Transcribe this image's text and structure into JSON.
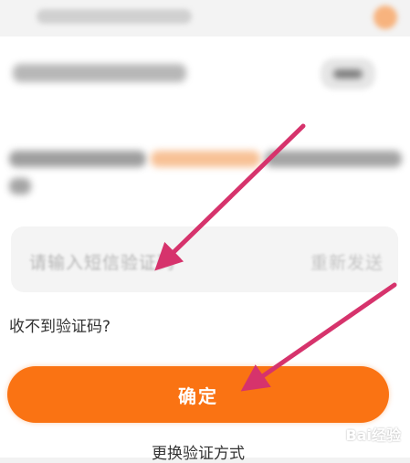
{
  "sms_field": {
    "placeholder": "请输入短信验证码",
    "resend_label": "重新发送"
  },
  "no_code_link": "收不到验证码?",
  "confirm_button": "确定",
  "switch_method_link": "更换验证方式",
  "watermark": "Bai经验",
  "colors": {
    "accent": "#fa7313",
    "arrow": "#d6336c"
  },
  "icons": [
    "arrow-annotation",
    "baidu-paw-icon"
  ]
}
